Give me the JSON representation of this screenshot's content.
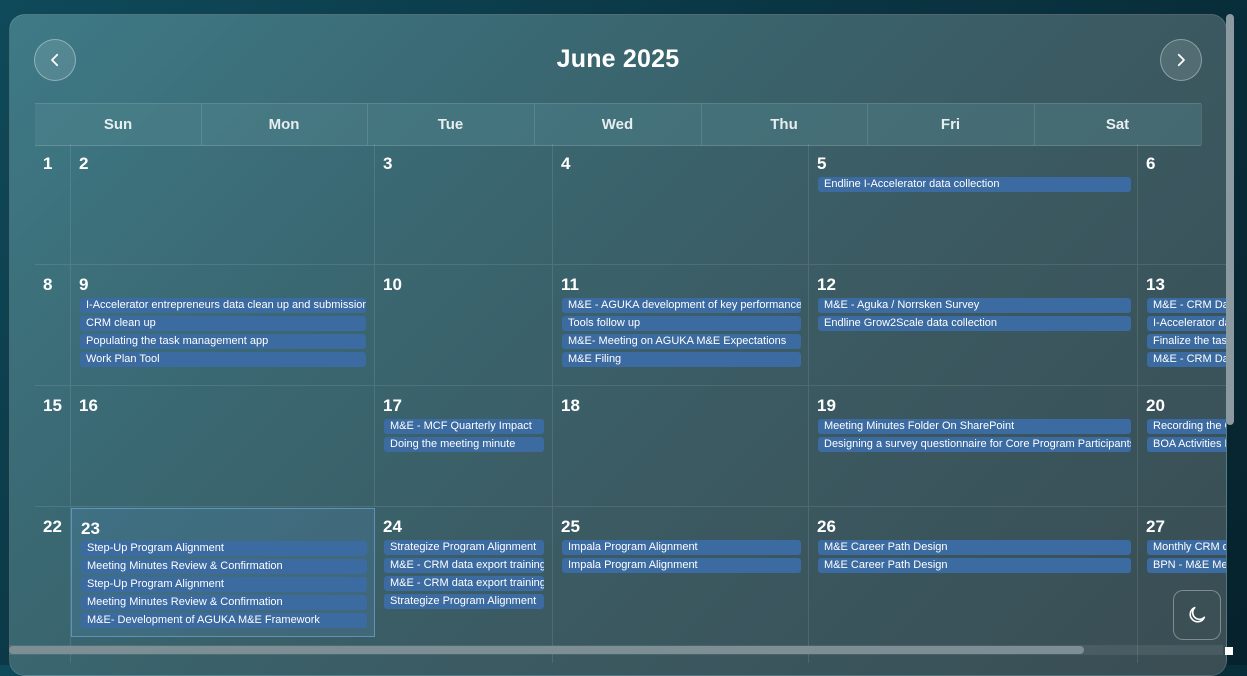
{
  "calendar": {
    "title": "June 2025"
  },
  "weekdays": [
    "Sun",
    "Mon",
    "Tue",
    "Wed",
    "Thu",
    "Fri",
    "Sat"
  ],
  "weeks": [
    {
      "days": [
        {
          "num": "1",
          "events": []
        },
        {
          "num": "2",
          "events": []
        },
        {
          "num": "3",
          "events": []
        },
        {
          "num": "4",
          "events": []
        },
        {
          "num": "5",
          "events": [
            "Endline I-Accelerator data collection"
          ]
        },
        {
          "num": "6",
          "events": []
        }
      ]
    },
    {
      "days": [
        {
          "num": "8",
          "events": []
        },
        {
          "num": "9",
          "events": [
            "I-Accelerator entrepreneurs data clean up and submission",
            "CRM clean up",
            "Populating the task management app",
            "Work Plan Tool"
          ]
        },
        {
          "num": "10",
          "events": []
        },
        {
          "num": "11",
          "events": [
            "M&E - AGUKA development of key performance",
            "Tools follow up",
            "M&E- Meeting on AGUKA M&E Expectations",
            "M&E Filing"
          ]
        },
        {
          "num": "12",
          "events": [
            "M&E - Aguka / Norrsken Survey",
            "Endline Grow2Scale data collection"
          ]
        },
        {
          "num": "13",
          "events": [
            "M&E - CRM Data",
            "I-Accelerator data",
            "Finalize the task",
            "M&E - CRM Data"
          ]
        }
      ]
    },
    {
      "days": [
        {
          "num": "15",
          "events": []
        },
        {
          "num": "16",
          "events": []
        },
        {
          "num": "17",
          "events": [
            "M&E - MCF Quarterly Impact",
            "Doing the meeting minute"
          ]
        },
        {
          "num": "18",
          "events": []
        },
        {
          "num": "19",
          "events": [
            "Meeting Minutes Folder On SharePoint",
            "Designing a survey questionnaire for Core Program Participants"
          ]
        },
        {
          "num": "20",
          "events": [
            "Recording the C",
            "BOA Activities F"
          ]
        }
      ]
    },
    {
      "days": [
        {
          "num": "22",
          "events": []
        },
        {
          "num": "23",
          "events": [
            "Step-Up Program Alignment",
            "Meeting Minutes Review & Confirmation",
            "Step-Up Program Alignment",
            "Meeting Minutes Review & Confirmation",
            "M&E- Development of AGUKA M&E Framework"
          ]
        },
        {
          "num": "24",
          "events": [
            "Strategize Program Alignment",
            "M&E - CRM data export training",
            "M&E - CRM data export training",
            "Strategize Program Alignment"
          ]
        },
        {
          "num": "25",
          "events": [
            "Impala Program Alignment",
            "Impala Program Alignment"
          ]
        },
        {
          "num": "26",
          "events": [
            "M&E Career Path Design",
            "M&E Career Path Design"
          ]
        },
        {
          "num": "27",
          "events": [
            "Monthly CRM d",
            "BPN - M&E Mer"
          ]
        }
      ]
    }
  ],
  "colors": {
    "event_bg": "#3b6ba0",
    "today_border": "#78b4e6"
  },
  "icons": {
    "prev": "chevron-left-icon",
    "next": "chevron-right-icon",
    "theme": "moon-icon"
  }
}
